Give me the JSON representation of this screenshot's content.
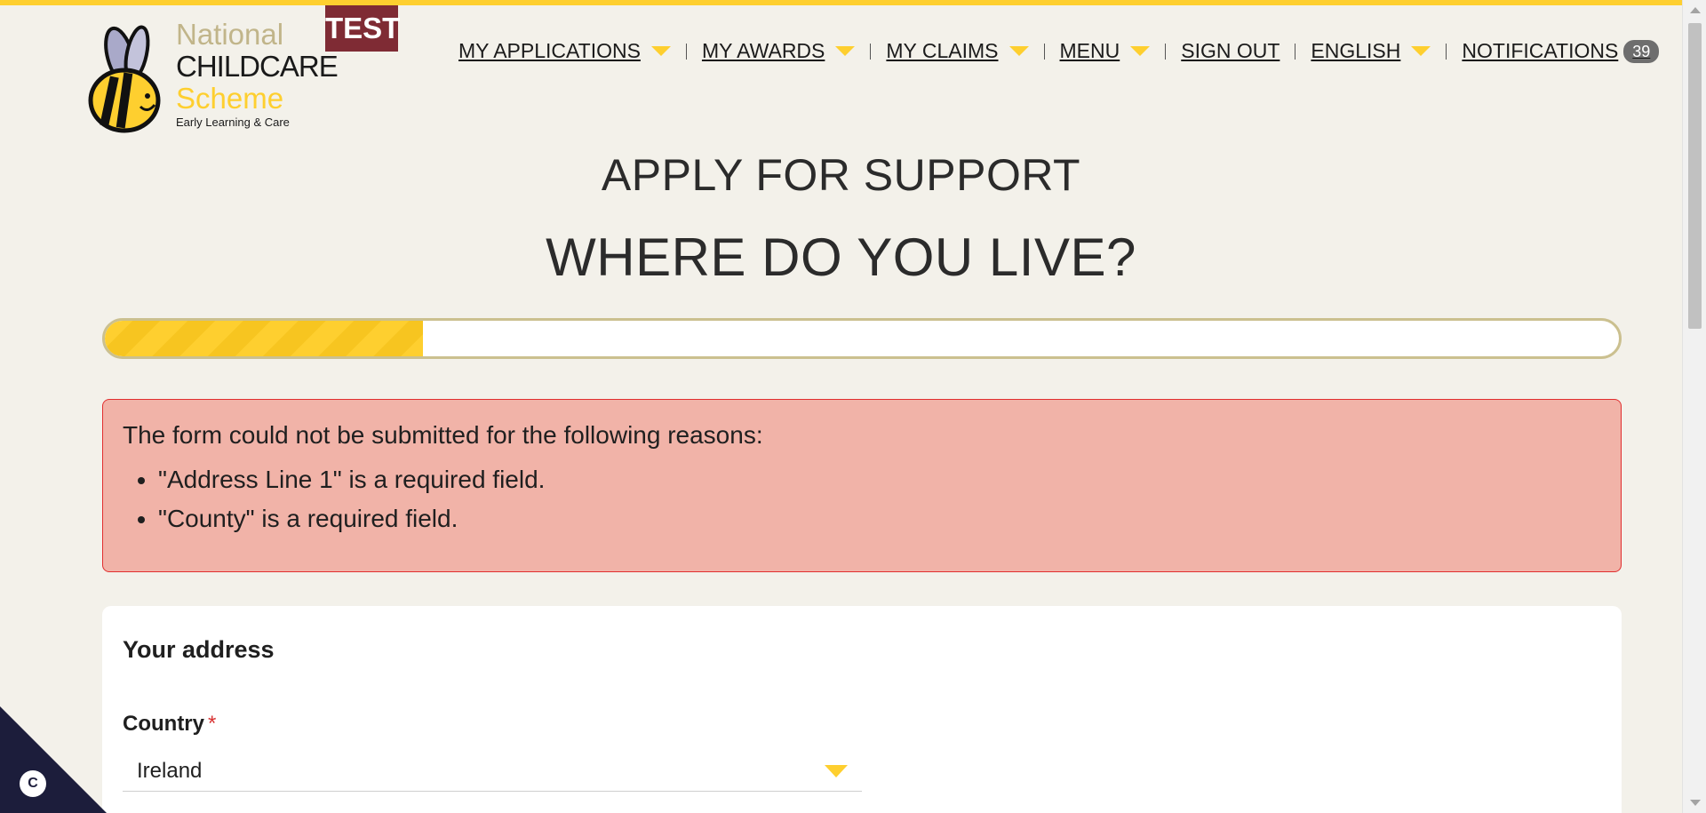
{
  "brand": {
    "line1": "National",
    "line2": "CHILDCARE",
    "line3": "Scheme",
    "line4": "Early Learning & Care",
    "test_label": "TEST"
  },
  "nav": {
    "items": [
      {
        "label": "MY APPLICATIONS"
      },
      {
        "label": "MY AWARDS"
      },
      {
        "label": "MY CLAIMS"
      },
      {
        "label": "MENU"
      },
      {
        "label": "SIGN OUT"
      },
      {
        "label": "ENGLISH"
      },
      {
        "label": "NOTIFICATIONS",
        "badge": "39"
      }
    ]
  },
  "page": {
    "heading": "APPLY FOR SUPPORT",
    "subheading": "WHERE DO YOU LIVE?",
    "progress": 0.21
  },
  "errors": {
    "title": "The form could not be submitted for the following reasons:",
    "items": [
      "\"Address Line 1\" is a required field.",
      "\"County\" is a required field."
    ]
  },
  "address": {
    "title": "Your address",
    "country_label": "Country",
    "required_mark": "*",
    "country_value": "Ireland"
  },
  "colors": {
    "accent": "#fecf2f",
    "error_bg": "#f1b3a8",
    "error_border": "#e12f2f",
    "test_badge": "#7f2b34"
  },
  "icons": {
    "cookie": "cookie-settings-icon",
    "caret": "chevron-down-icon"
  }
}
